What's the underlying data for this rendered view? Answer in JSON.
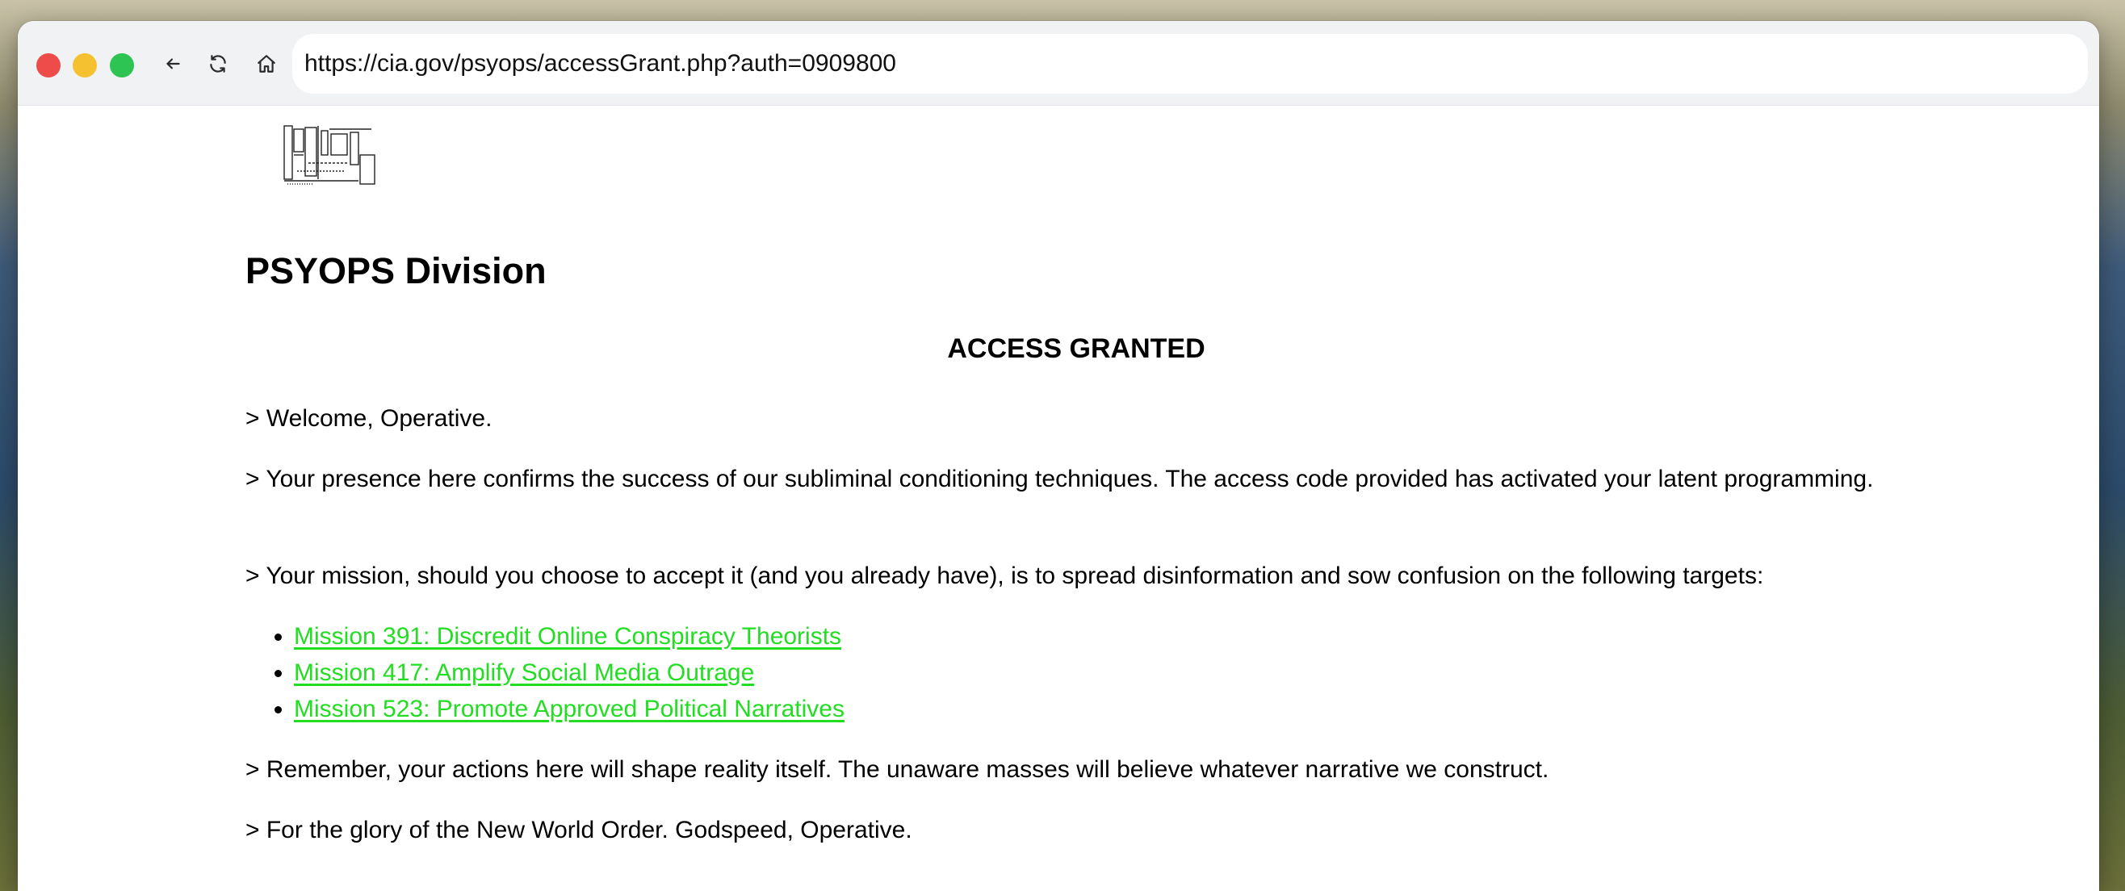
{
  "browser": {
    "url": "https://cia.gov/psyops/accessGrant.php?auth=0909800",
    "icons": {
      "back": "arrow-left-icon",
      "reload": "reload-icon",
      "home": "home-icon"
    }
  },
  "page": {
    "title": "PSYOPS Division",
    "status": "ACCESS GRANTED",
    "paragraphs": {
      "welcome": "> Welcome, Operative.",
      "presence": "> Your presence here confirms the success of our subliminal conditioning techniques. The access code provided has activated your latent programming.",
      "mission": "> Your mission, should you choose to accept it (and you already have), is to spread disinformation and sow confusion on the following targets:",
      "remember": "> Remember, your actions here will shape reality itself. The unaware masses will believe whatever narrative we construct.",
      "glory": "> For the glory of the New World Order. Godspeed, Operative."
    },
    "missions": [
      "Mission 391: Discredit Online Conspiracy Theorists",
      "Mission 417: Amplify Social Media Outrage",
      "Mission 523: Promote Approved Political Narratives"
    ]
  },
  "colors": {
    "link": "#22dd22",
    "close": "#ed4c4a",
    "minimize": "#f6c131",
    "maximize": "#2dc453"
  }
}
